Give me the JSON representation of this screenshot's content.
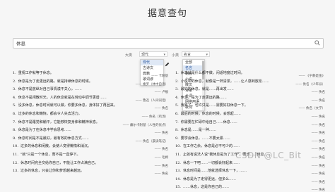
{
  "page": {
    "title": "据意查句"
  },
  "search": {
    "value": "休息"
  },
  "filters": {
    "filter1": {
      "label": "大类",
      "value": "现代"
    },
    "filter2": {
      "label": "小类",
      "value": "名言"
    }
  },
  "dropdown_left": {
    "options": [
      "现代",
      "古诗文",
      "典籍",
      "歌词谚"
    ],
    "selected_index": 0
  },
  "dropdown_right": {
    "options": [
      "全部",
      "名言",
      "格言",
      "小说",
      "散文",
      "诗歌",
      "台词",
      "网络用语",
      "歌词"
    ],
    "selected_index": 1
  },
  "left_quotes": [
    {
      "num": "1.",
      "text": "重视工作就等于休息。",
      "src": "—— 卡耐基"
    },
    {
      "num": "2.",
      "text": "休息是为了走更远的路，就是持续休息的时候。",
      "src": "—— 梭罗（林中自语）"
    },
    {
      "num": "3.",
      "text": "休息不是放纵对自己事情漠不关心，……",
      "src": "—— 卢梭"
    },
    {
      "num": "4.",
      "text": "休息不是闲散时光，人的休息就是在劳动中调节更替……",
      "src": "—— 鲁迅（人间词话）"
    },
    {
      "num": "5.",
      "text": "没多休息，休息时间就可以做，你要多休息，身体好了再回来。",
      "src": "—— 佚名"
    },
    {
      "num": "6.",
      "text": "过多的休息和懒惰，都会令人失去活力。",
      "src": "—— 佚名（鸡汤）"
    },
    {
      "num": "7.",
      "text": "休息不是睡觉和躺平，它能够恢复身体和精神状态。",
      "src": "—— 戴尔卡耐基（人性的优点）"
    },
    {
      "num": "8.",
      "text": "休息是为了在休息中学会思考……",
      "src": "—— 佚名"
    },
    {
      "num": "9.",
      "text": "休息时间是不是最好，最有效的休息方式……",
      "src": "—— 佚名（晨读笔记）"
    },
    {
      "num": "10.",
      "text": "过多的休息和闲散，会使人变得懒惰和消沉。",
      "src": "—— 佚名"
    },
    {
      "num": "11.",
      "text": "\"就\"只是一个休息，而不是一直停下。",
      "src": "—— 毛姆"
    },
    {
      "num": "12.",
      "text": "休息时间完全交给你自己，不能让工作占满自己。",
      "src": "—— 佚名"
    },
    {
      "num": "13.",
      "text": "过多的休息，只会让你和梦想越来越远。",
      "src": "—— 佚名"
    }
  ],
  "right_quotes": [
    {
      "num": "1.",
      "text": "休息就是什么都不做，闲适地度过时间。",
      "src": "—— 《宁静是金》"
    },
    {
      "num": "2.",
      "text": "小说中的休息，就像是一杯清茶，……让人感到放松……",
      "src": "—— 佚名（少年派）"
    },
    {
      "num": "3.",
      "text": "最好的休息，就是……再出发……",
      "src": "—— 佚名"
    },
    {
      "num": "4.",
      "text": "休息，是为了走更远的路……",
      "src": "—— 佚名"
    },
    {
      "num": "5.",
      "text": "我累了，也许只是……需要好好休息一下。",
      "src": "—— 佚名（文学）"
    },
    {
      "num": "6.",
      "text": "最后的时候，休息的时候，会想起……",
      "src": "—— 佚名"
    },
    {
      "num": "7.",
      "text": "你需要在忙碌中给自己……休息……",
      "src": "—— 佚名"
    },
    {
      "num": "8.",
      "text": "休息是……是一种……",
      "src": "—— 佚名"
    },
    {
      "num": "9.",
      "text": "要学会休息，……不要太累……",
      "src": "—— 佚名"
    },
    {
      "num": "10.",
      "text": "在工作之余，休息是必不可少的……",
      "src": "—— 佚名"
    },
    {
      "num": "11.",
      "text": "止如有说法人说\"我休息是为了工作\"，表示……休息……",
      "src": "—— 佚名"
    },
    {
      "num": "12.",
      "text": "休息一下吧……一切都会好起来……",
      "src": "—— 佚名"
    },
    {
      "num": "13.",
      "text": "休息时间是……他就选择休息一下，……",
      "src": "—— 佚名"
    },
    {
      "num": "14.",
      "text": "休息是为了走得更远，但多么……",
      "src": "—— 佚名"
    },
    {
      "num": "15.",
      "text": "……休息，这是你自己的……",
      "src": "—— 佚名"
    }
  ],
  "watermark": {
    "text": "CSDN @LC_Bit"
  }
}
